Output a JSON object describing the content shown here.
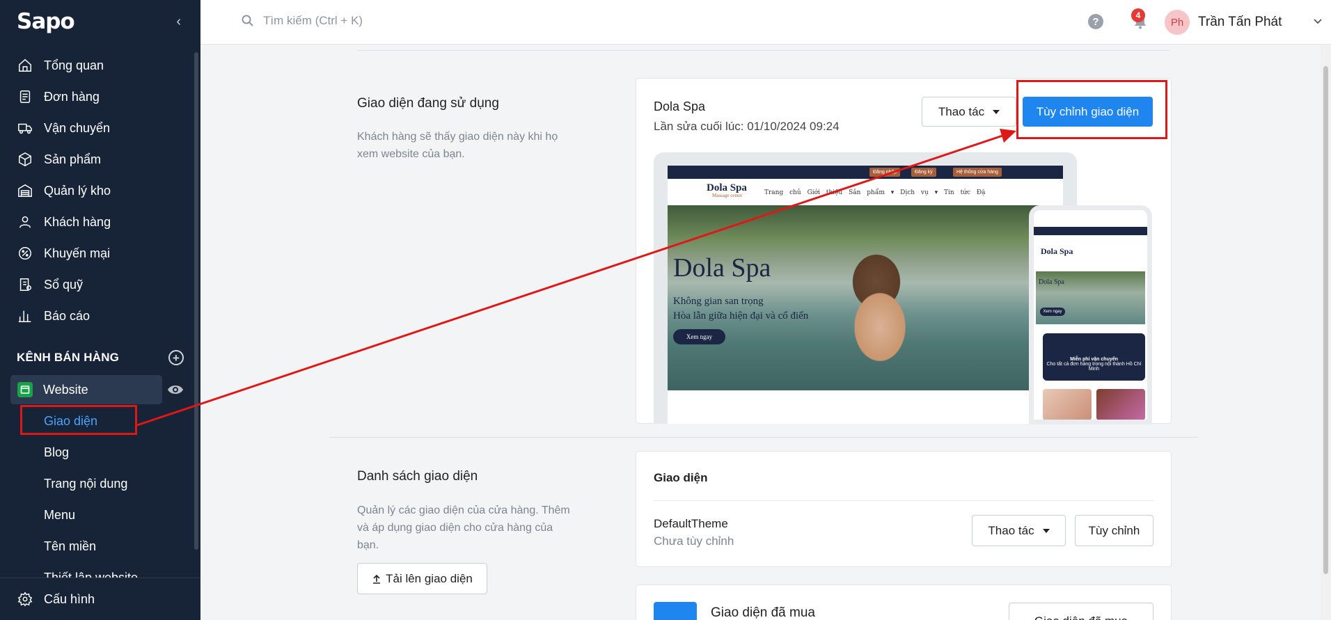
{
  "sidebar": {
    "logo": "Sapo",
    "items": [
      {
        "label": "Tổng quan",
        "icon": "home-icon"
      },
      {
        "label": "Đơn hàng",
        "icon": "order-icon"
      },
      {
        "label": "Vận chuyển",
        "icon": "truck-icon"
      },
      {
        "label": "Sản phẩm",
        "icon": "box-icon"
      },
      {
        "label": "Quản lý kho",
        "icon": "warehouse-icon"
      },
      {
        "label": "Khách hàng",
        "icon": "user-icon"
      },
      {
        "label": "Khuyến mại",
        "icon": "discount-icon"
      },
      {
        "label": "Sổ quỹ",
        "icon": "ledger-icon"
      },
      {
        "label": "Báo cáo",
        "icon": "chart-icon"
      }
    ],
    "channel_title": "KÊNH BÁN HÀNG",
    "website_label": "Website",
    "sub_items": [
      "Giao diện",
      "Blog",
      "Trang nội dung",
      "Menu",
      "Tên miền",
      "Thiết lập website"
    ],
    "settings_label": "Cấu hình"
  },
  "topbar": {
    "search_placeholder": "Tìm kiếm (Ctrl + K)",
    "notification_count": "4",
    "avatar_initials": "Ph",
    "user_name": "Trần Tấn Phát"
  },
  "current_theme": {
    "title": "Giao diện đang sử dụng",
    "description_line1": "Khách hàng sẽ thấy giao diện này khi họ",
    "description_line2": "xem website của bạn.",
    "theme_name": "Dola Spa",
    "last_edited": "Lần sửa cuối lúc: 01/10/2024 09:24",
    "actions_label": "Thao tác",
    "customize_label": "Tùy chỉnh giao diện"
  },
  "preview": {
    "top_links": [
      "Đăng nhập",
      "Đăng ký",
      "Hệ thống cửa hàng"
    ],
    "site_logo": "Dola Spa",
    "site_tagline": "Massage center",
    "menu": "Trang chủ Giới thiệu Sản phẩm ▾ Dịch vụ ▾ Tin tức Đặ",
    "hero_title": "Dola Spa",
    "hero_line1": "Không gian san trọng",
    "hero_line2": "Hòa lẫn giữa hiện đại và cổ điển",
    "hero_button": "Xem ngay",
    "phone_logo": "Dola Spa",
    "phone_hero": "Dola Spa",
    "phone_button": "Xem ngay",
    "phone_card_title": "Miễn phí vận chuyển",
    "phone_card_text": "Cho tất cả đơn hàng trong nội thành Hồ Chí Minh"
  },
  "theme_list": {
    "title": "Danh sách giao diện",
    "description_line1": "Quản lý các giao diện của cửa hàng. Thêm",
    "description_line2": "và áp dụng giao diện cho cửa hàng của",
    "description_line3": "bạn.",
    "upload_label": "Tải lên giao diện",
    "card_title": "Giao diện",
    "default_theme_name": "DefaultTheme",
    "default_theme_status": "Chưa tùy chỉnh",
    "actions_label": "Thao tác",
    "customize_label": "Tùy chỉnh"
  },
  "purchased": {
    "title": "Giao diện đã mua",
    "button_label": "Giao diện đã mua"
  },
  "colors": {
    "sidebar_bg": "#172437",
    "primary": "#1f86f0",
    "annotation": "#e01717",
    "active_link": "#4aa3ff"
  }
}
